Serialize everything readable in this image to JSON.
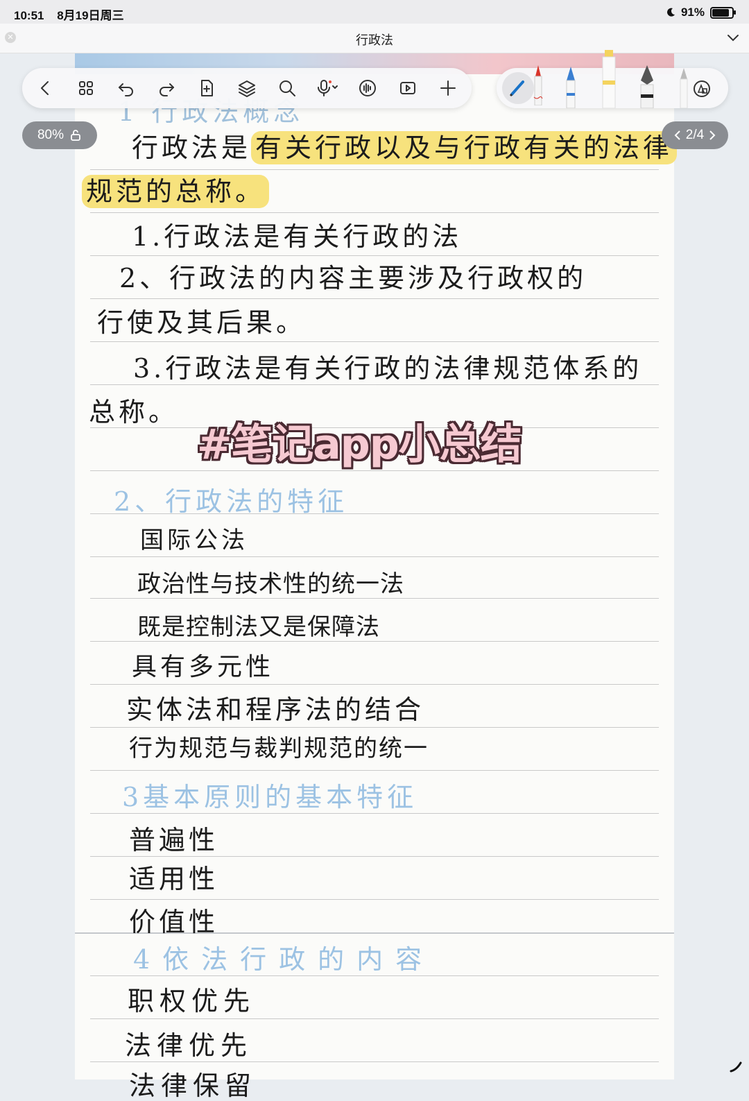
{
  "status_bar": {
    "time": "10:51",
    "date": "8月19日周三",
    "battery": "91%",
    "battery_level": 0.91
  },
  "title_bar": {
    "title": "行政法"
  },
  "toolbar": {
    "icons": [
      "back-icon",
      "grid-icon",
      "undo-icon",
      "redo-icon",
      "add-page-icon",
      "layers-icon",
      "search-icon",
      "microphone-icon",
      "audio-wave-icon",
      "play-icon",
      "plus-icon"
    ],
    "pens": [
      "pen-icon",
      "marker-icon",
      "highlighter-icon",
      "fountain-pen-icon",
      "pencil-icon",
      "shapes-icon"
    ]
  },
  "zoom": {
    "label": "80%"
  },
  "page_indicator": {
    "label": "2/4"
  },
  "notes": {
    "s1_heading_partial": "1 行政法概念",
    "line1_prefix": "行政法是",
    "line1_highlight": "有关行政以及与行政有关的法律",
    "line2_highlight": "规范的总称。",
    "item1": "1.行政法是有关行政的法",
    "item2_a": "2、行政法的内容主要涉及行政权的",
    "item2_b": "行使及其后果。",
    "item3_a": "3.行政法是有关行政的法律规范体系的",
    "item3_b": "总称。",
    "s2_heading": "2、行政法的特征",
    "s2_items": [
      "国际公法",
      "政治性与技术性的统一法",
      "既是控制法又是保障法",
      "具有多元性",
      "实体法和程序法的结合",
      "行为规范与裁判规范的统一"
    ],
    "s3_heading": "3基本原则的基本特征",
    "s3_items": [
      "普遍性",
      "适用性",
      "价值性"
    ],
    "s4_heading": "4依法行政的内容",
    "s4_items": [
      "职权优先",
      "法律优先",
      "法律保留"
    ]
  },
  "overlay": {
    "tag": "#笔记app小总结"
  }
}
